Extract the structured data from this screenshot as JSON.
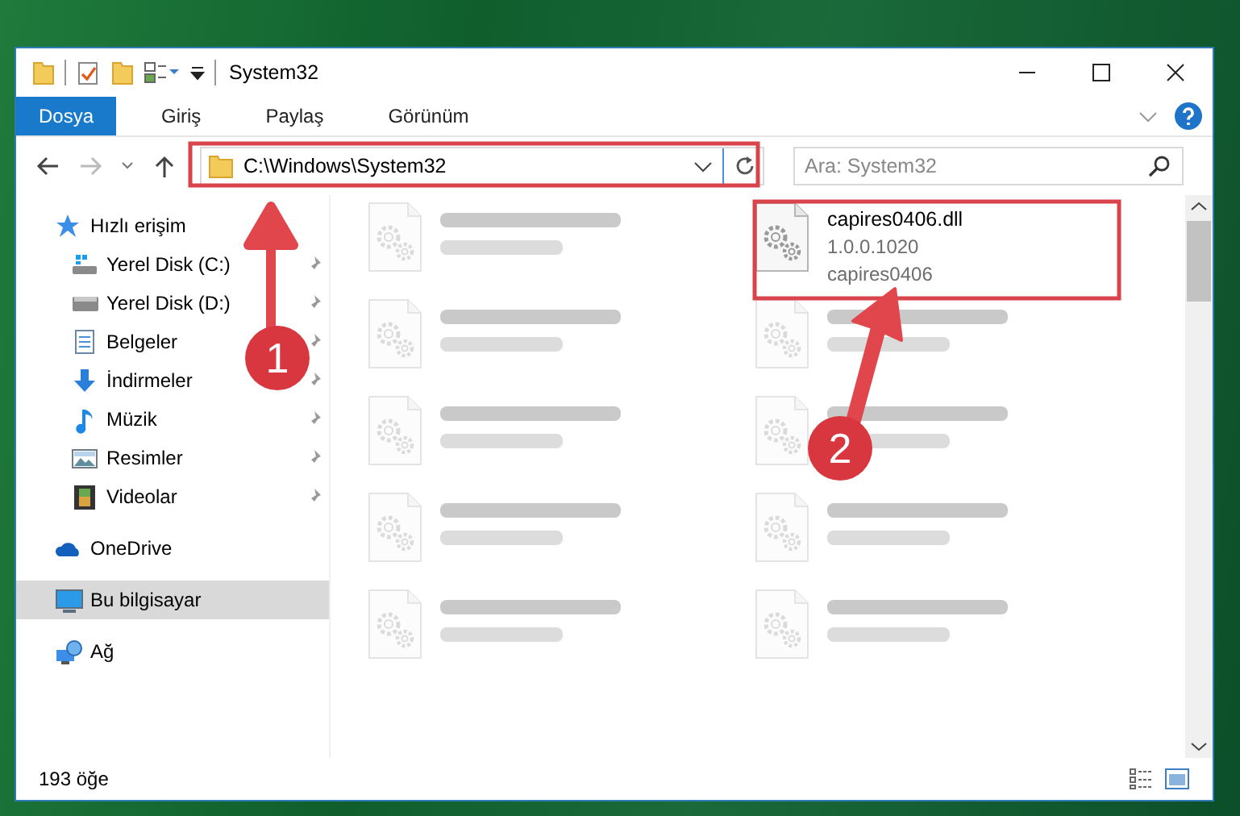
{
  "window": {
    "title": "System32"
  },
  "ribbon_tabs": [
    {
      "label": "Dosya",
      "selected": true
    },
    {
      "label": "Giriş",
      "selected": false
    },
    {
      "label": "Paylaş",
      "selected": false
    },
    {
      "label": "Görünüm",
      "selected": false
    }
  ],
  "address_bar": {
    "value": "C:\\Windows\\System32"
  },
  "search": {
    "placeholder": "Ara: System32"
  },
  "sidebar": {
    "items": [
      {
        "label": "Hızlı erişim",
        "selected": false,
        "children": [
          {
            "label": "Yerel Disk (C:)",
            "pinned": true,
            "selected": false
          },
          {
            "label": "Yerel Disk (D:)",
            "pinned": true,
            "selected": false
          },
          {
            "label": "Belgeler",
            "pinned": true,
            "selected": false
          },
          {
            "label": "İndirmeler",
            "pinned": true,
            "selected": false
          },
          {
            "label": "Müzik",
            "pinned": true,
            "selected": false
          },
          {
            "label": "Resimler",
            "pinned": true,
            "selected": false
          },
          {
            "label": "Videolar",
            "pinned": true,
            "selected": false
          }
        ]
      },
      {
        "label": "OneDrive",
        "selected": false
      },
      {
        "label": "Bu bilgisayar",
        "selected": true
      },
      {
        "label": "Ağ",
        "selected": false
      }
    ]
  },
  "files": [
    {
      "blurred": true
    },
    {
      "name": "capires0406.dll",
      "line_2": "1.0.0.1020",
      "line_3": "capires0406",
      "blurred": false
    },
    {
      "blurred": true
    },
    {
      "blurred": true
    },
    {
      "blurred": true
    },
    {
      "blurred": true
    },
    {
      "blurred": true
    },
    {
      "blurred": true
    },
    {
      "blurred": true
    },
    {
      "blurred": true
    }
  ],
  "status_bar": {
    "text": "193 öğe"
  },
  "annotations": [
    {
      "label": "1"
    },
    {
      "label": "2"
    }
  ]
}
